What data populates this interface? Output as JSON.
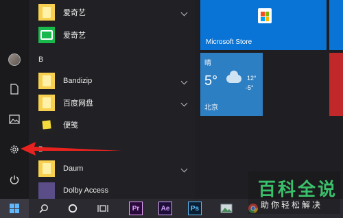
{
  "app_list": {
    "items": [
      {
        "type": "app",
        "label": "爱奇艺",
        "icon": "folder",
        "expandable": true
      },
      {
        "type": "app",
        "label": "爱奇艺",
        "icon": "iqiyi",
        "expandable": false
      },
      {
        "type": "letter",
        "label": "B"
      },
      {
        "type": "app",
        "label": "Bandizip",
        "icon": "folder",
        "expandable": true
      },
      {
        "type": "app",
        "label": "百度网盘",
        "icon": "folder",
        "expandable": true
      },
      {
        "type": "app",
        "label": "便笺",
        "icon": "note",
        "expandable": false
      },
      {
        "type": "letter",
        "label": "D"
      },
      {
        "type": "app",
        "label": "Daum",
        "icon": "folder",
        "expandable": true
      },
      {
        "type": "app",
        "label": "Dolby Access",
        "icon": "dolby",
        "expandable": false
      }
    ]
  },
  "tiles": {
    "store_label": "Microsoft Store",
    "weather": {
      "title": "晴",
      "temp": "5°",
      "high": "12°",
      "low": "-5°",
      "city": "北京"
    }
  },
  "taskbar": {
    "pr": "Pr",
    "ae": "Ae",
    "ps": "Ps"
  },
  "watermark": {
    "big": "百科全说",
    "small": "助你轻松解决"
  },
  "colors": {
    "store_blue": "#0a74d6",
    "weather_blue": "#2d7fc4",
    "arrow_red": "#e8231f",
    "watermark_green": "#3ac06a"
  }
}
